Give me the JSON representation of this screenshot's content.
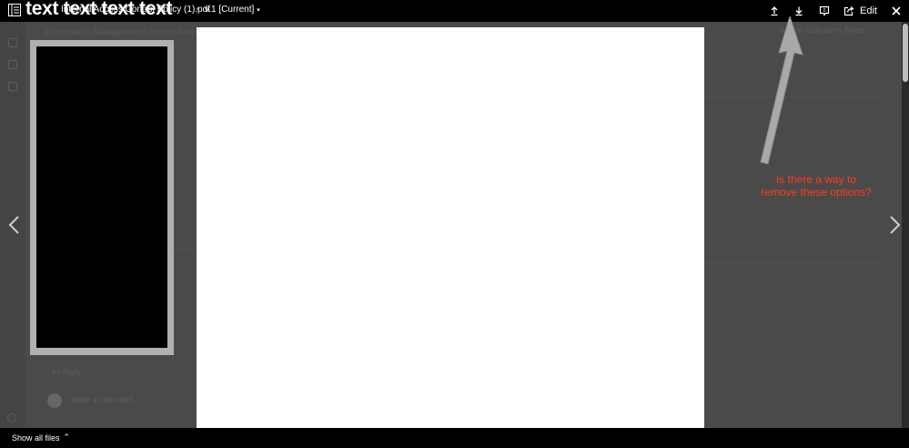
{
  "overlay": {
    "text": "text text text text"
  },
  "header": {
    "filename": "Internal Access Control Policy (1).pdf",
    "separator": "•",
    "version": "v.1 [Current]",
    "version_caret": "▾",
    "buttons": {
      "upload": "upload-icon",
      "download": "download-icon",
      "comments": "comment-icon",
      "share": "share-icon",
      "edit_label": "Edit",
      "close": "close-icon"
    }
  },
  "annotation": {
    "line1": "Is there a way to",
    "line2": "remove these options?",
    "color": "#ff3b1f"
  },
  "footer": {
    "show_all_label": "Show all files",
    "show_all_icon": "⌃"
  },
  "background_app": {
    "breadcrumb": "Documents  ›  Management  ›  Access Policies",
    "right_actions": "Add to Collection     Share",
    "like_row": "Like    Reply",
    "comment_placeholder": "Write a comment..."
  }
}
